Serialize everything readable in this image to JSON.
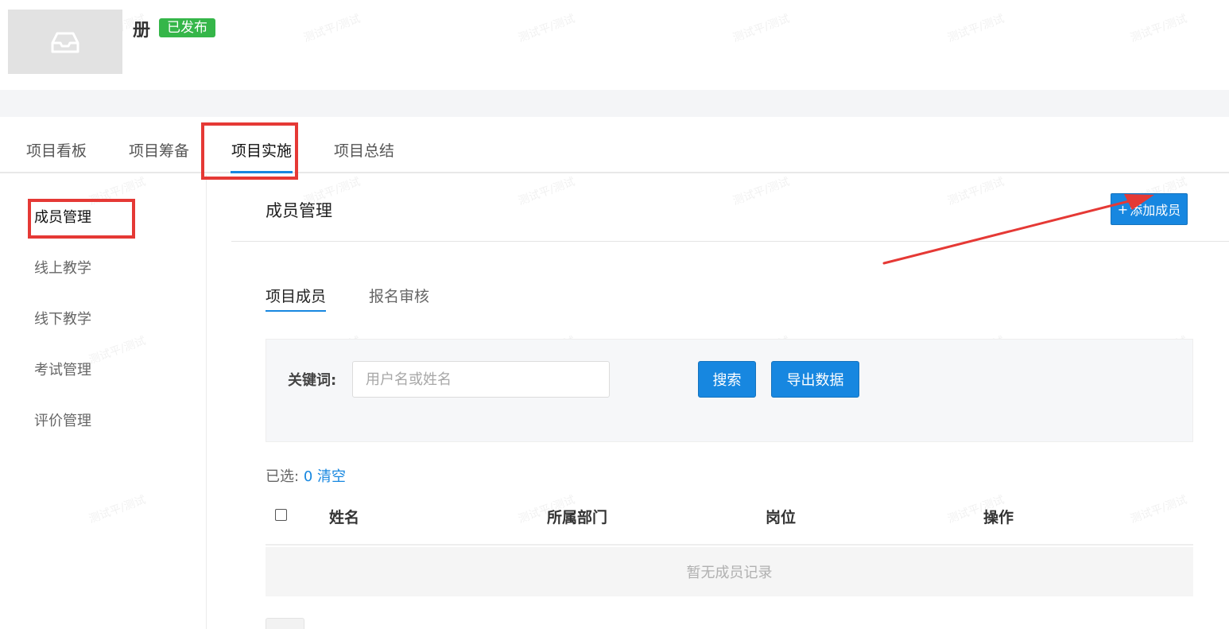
{
  "header": {
    "title": "册",
    "status_badge": "已发布"
  },
  "top_tabs": [
    {
      "label": "项目看板"
    },
    {
      "label": "项目筹备"
    },
    {
      "label": "项目实施"
    },
    {
      "label": "项目总结"
    }
  ],
  "sidebar": {
    "items": [
      {
        "label": "成员管理"
      },
      {
        "label": "线上教学"
      },
      {
        "label": "线下教学"
      },
      {
        "label": "考试管理"
      },
      {
        "label": "评价管理"
      }
    ]
  },
  "main": {
    "section_title": "成员管理",
    "add_button": "添加成员",
    "sub_tabs": [
      {
        "label": "项目成员"
      },
      {
        "label": "报名审核"
      }
    ],
    "filter": {
      "keyword_label": "关键词:",
      "keyword_placeholder": "用户名或姓名",
      "search_button": "搜索",
      "export_button": "导出数据"
    },
    "selection": {
      "prefix": "已选:",
      "count": "0",
      "clear": "清空"
    },
    "table": {
      "columns": [
        "姓名",
        "所属部门",
        "岗位",
        "操作"
      ],
      "empty_text": "暂无成员记录"
    }
  },
  "watermark": {
    "text": "测试平/测试"
  },
  "colors": {
    "accent": "#1787e0",
    "badge_green": "#35b649",
    "annotation_red": "#e53935"
  }
}
